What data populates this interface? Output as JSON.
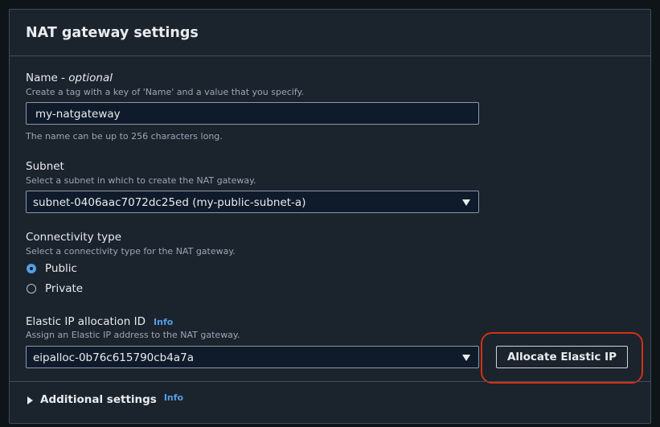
{
  "panel": {
    "title": "NAT gateway settings"
  },
  "name_field": {
    "label": "Name - ",
    "optional": "optional",
    "description": "Create a tag with a key of 'Name' and a value that you specify.",
    "value": "my-natgateway",
    "constraint": "The name can be up to 256 characters long."
  },
  "subnet_field": {
    "label": "Subnet",
    "description": "Select a subnet in which to create the NAT gateway.",
    "selected": "subnet-0406aac7072dc25ed (my-public-subnet-a)"
  },
  "connectivity_field": {
    "label": "Connectivity type",
    "description": "Select a connectivity type for the NAT gateway.",
    "options": [
      {
        "label": "Public",
        "checked": true
      },
      {
        "label": "Private",
        "checked": false
      }
    ]
  },
  "eip_field": {
    "label": "Elastic IP allocation ID",
    "info": "Info",
    "description": "Assign an Elastic IP address to the NAT gateway.",
    "selected": "eipalloc-0b76c615790cb4a7a",
    "allocate_button": "Allocate Elastic IP",
    "highlight_color": "#d13212"
  },
  "additional_settings": {
    "label": "Additional settings",
    "info": "Info"
  },
  "colors": {
    "background": "#0f1419",
    "panel": "#1b232d",
    "accent": "#539fe5",
    "border": "#414d5c"
  }
}
